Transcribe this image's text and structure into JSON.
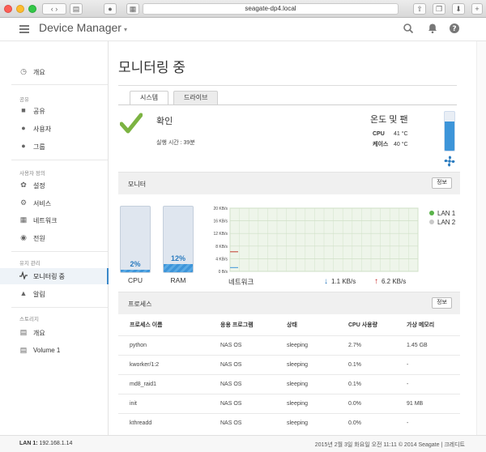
{
  "browser": {
    "url": "seagate-dp4.local"
  },
  "app": {
    "title": "Device Manager"
  },
  "sidebar": {
    "overview": "개요",
    "sections": [
      {
        "title": "공유",
        "items": [
          "공유",
          "사용자",
          "그룹"
        ]
      },
      {
        "title": "사용자 정의",
        "items": [
          "설정",
          "서비스",
          "네트워크",
          "전원"
        ]
      },
      {
        "title": "유지 관리",
        "items": [
          "모니터링 중",
          "알림"
        ]
      },
      {
        "title": "스토리지",
        "items": [
          "개요",
          "Volume 1"
        ]
      }
    ]
  },
  "page": {
    "title": "모니터링 중",
    "tabs": [
      "시스템",
      "드라이브"
    ],
    "status": {
      "title": "확인",
      "runtime": "실행 시간 : 39분"
    },
    "temperature": {
      "title": "온도 및 팬",
      "rows": [
        {
          "label": "CPU",
          "value": "41 °C"
        },
        {
          "label": "케이스",
          "value": "40 °C"
        }
      ],
      "level": 0.75
    },
    "monitor": {
      "title": "모니터",
      "info_button": "정보",
      "cpu": {
        "label": "CPU",
        "percent": "2%",
        "fraction": 0.02
      },
      "ram": {
        "label": "RAM",
        "percent": "12%",
        "fraction": 0.12
      },
      "network": {
        "label": "네트워크",
        "y_ticks": [
          "20 KB/s",
          "16 KB/s",
          "12 KB/s",
          "8 KB/s",
          "4 KB/s",
          "0 B/s"
        ],
        "legend": [
          "LAN 1",
          "LAN 2"
        ],
        "down": "1.1 KB/s",
        "up": "6.2 KB/s"
      }
    },
    "processes": {
      "title": "프로세스",
      "info_button": "정보",
      "headers": [
        "프로세스 이름",
        "응용 프로그램",
        "상태",
        "CPU 사용량",
        "가상 메모리"
      ],
      "rows": [
        [
          "python",
          "NAS OS",
          "sleeping",
          "2.7%",
          "1.45 GB"
        ],
        [
          "kworker/1:2",
          "NAS OS",
          "sleeping",
          "0.1%",
          "-"
        ],
        [
          "md8_raid1",
          "NAS OS",
          "sleeping",
          "0.1%",
          "-"
        ],
        [
          "init",
          "NAS OS",
          "sleeping",
          "0.0%",
          "91 MB"
        ],
        [
          "kthreadd",
          "NAS OS",
          "sleeping",
          "0.0%",
          "-"
        ]
      ]
    }
  },
  "footer": {
    "lan_label": "LAN 1:",
    "lan_ip": "192.168.1.14",
    "right": "2015년 2월 3일 화요일  오전 11:11  © 2014 Seagate | 크레디트"
  },
  "chart_data": {
    "type": "line",
    "ylim": [
      0,
      20
    ],
    "y_unit": "KB/s",
    "series": [
      {
        "name": "LAN 1",
        "color": "#59b34a",
        "values": [
          1.2,
          1.2
        ]
      },
      {
        "name": "LAN 2",
        "color": "#bfbfbf",
        "values": [
          6.2,
          6.2
        ]
      }
    ]
  }
}
